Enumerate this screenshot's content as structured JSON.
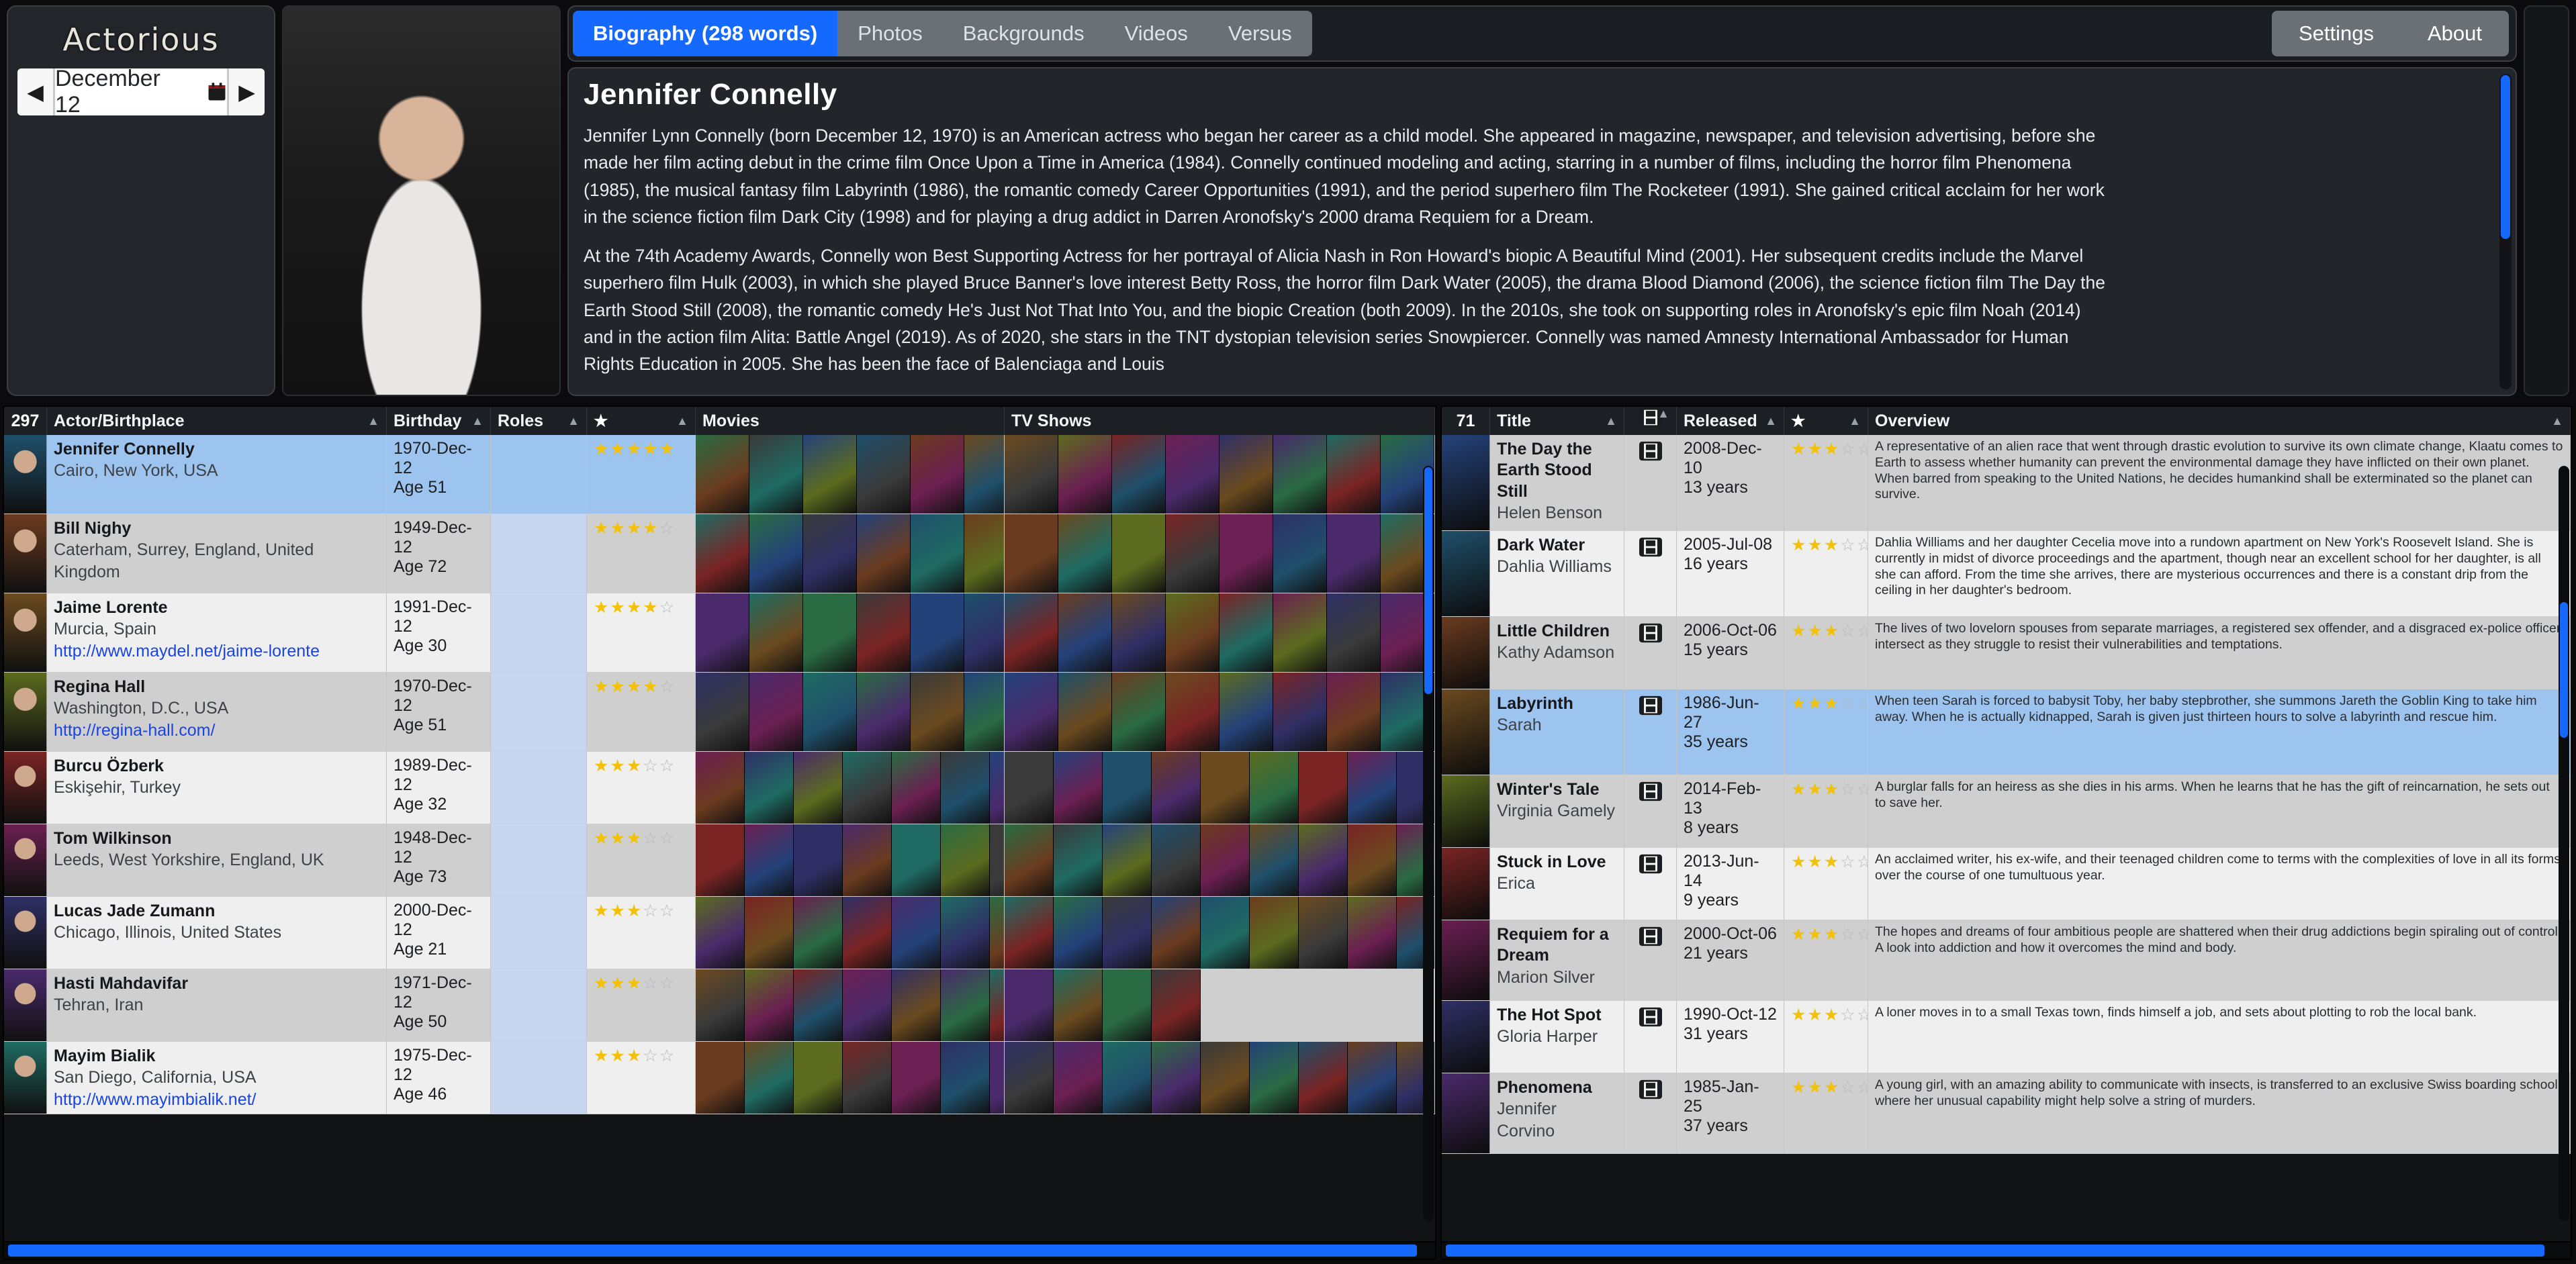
{
  "app": {
    "title": "Actorious"
  },
  "date_nav": {
    "prev": "◀",
    "next": "▶",
    "value": "December 12",
    "icon": "calendar-icon"
  },
  "tabs": [
    {
      "label": "Biography (298 words)",
      "active": true
    },
    {
      "label": "Photos",
      "active": false
    },
    {
      "label": "Backgrounds",
      "active": false
    },
    {
      "label": "Videos",
      "active": false
    },
    {
      "label": "Versus",
      "active": false
    }
  ],
  "top_buttons": [
    {
      "label": "Settings"
    },
    {
      "label": "About"
    }
  ],
  "biography": {
    "name": "Jennifer Connelly",
    "paragraphs": [
      "Jennifer Lynn Connelly (born December 12, 1970) is an American actress who began her career as a child model. She appeared in magazine, newspaper, and television advertising, before she made her film acting debut in the crime film Once Upon a Time in America (1984). Connelly continued modeling and acting, starring in a number of films, including the horror film Phenomena (1985), the musical fantasy film Labyrinth (1986), the romantic comedy Career Opportunities (1991), and the period superhero film The Rocketeer (1991). She gained critical acclaim for her work in the science fiction film Dark City (1998) and for playing a drug addict in Darren Aronofsky's 2000 drama Requiem for a Dream.",
      "At the 74th Academy Awards, Connelly won Best Supporting Actress for her portrayal of Alicia Nash in Ron Howard's biopic A Beautiful Mind (2001). Her subsequent credits include the Marvel superhero film Hulk (2003), in which she played Bruce Banner's love interest Betty Ross, the horror film Dark Water (2005), the drama Blood Diamond (2006), the science fiction film The Day the Earth Stood Still (2008), the romantic comedy He's Just Not That Into You, and the biopic Creation (both 2009). In the 2010s, she took on supporting roles in Aronofsky's epic film Noah (2014) and in the action film Alita: Battle Angel (2019). As of 2020, she stars in the TNT dystopian television series Snowpiercer. Connelly was named Amnesty International Ambassador for Human Rights Education in 2005. She has been the face of Balenciaga and Louis"
    ]
  },
  "actors_grid": {
    "count": "297",
    "columns": [
      {
        "label": "Actor/Birthplace",
        "sortable": true
      },
      {
        "label": "Birthday",
        "sortable": true
      },
      {
        "label": "Roles",
        "sortable": true
      },
      {
        "label": "★",
        "sortable": true
      },
      {
        "label": "Movies",
        "sortable": false
      },
      {
        "label": "TV Shows",
        "sortable": false
      }
    ],
    "rows": [
      {
        "name": "Jennifer Connelly",
        "birthplace": "Cairo, New York, USA",
        "url": "",
        "birthday": "1970-Dec-12",
        "age": "Age 51",
        "roles": "",
        "stars": 5,
        "selected": true
      },
      {
        "name": "Bill Nighy",
        "birthplace": "Caterham, Surrey, England, United Kingdom",
        "url": "",
        "birthday": "1949-Dec-12",
        "age": "Age 72",
        "roles": "",
        "stars": 4,
        "selected": false
      },
      {
        "name": "Jaime Lorente",
        "birthplace": "Murcia, Spain",
        "url": "http://www.maydel.net/jaime-lorente",
        "birthday": "1991-Dec-12",
        "age": "Age 30",
        "roles": "",
        "stars": 4,
        "selected": false
      },
      {
        "name": "Regina Hall",
        "birthplace": "Washington, D.C., USA",
        "url": "http://regina-hall.com/",
        "birthday": "1970-Dec-12",
        "age": "Age 51",
        "roles": "",
        "stars": 4,
        "selected": false
      },
      {
        "name": "Burcu Özberk",
        "birthplace": "Eskişehir, Turkey",
        "url": "",
        "birthday": "1989-Dec-12",
        "age": "Age 32",
        "roles": "",
        "stars": 3,
        "selected": false
      },
      {
        "name": "Tom Wilkinson",
        "birthplace": "Leeds, West Yorkshire, England, UK",
        "url": "",
        "birthday": "1948-Dec-12",
        "age": "Age 73",
        "roles": "",
        "stars": 3,
        "selected": false
      },
      {
        "name": "Lucas Jade Zumann",
        "birthplace": "Chicago, Illinois, United States",
        "url": "",
        "birthday": "2000-Dec-12",
        "age": "Age 21",
        "roles": "",
        "stars": 3,
        "selected": false
      },
      {
        "name": "Hasti Mahdavifar",
        "birthplace": "Tehran, Iran",
        "url": "",
        "birthday": "1971-Dec-12",
        "age": "Age 50",
        "roles": "",
        "stars": 3,
        "selected": false
      },
      {
        "name": "Mayim Bialik",
        "birthplace": "San Diego, California, USA",
        "url": "http://www.mayimbialik.net/",
        "birthday": "1975-Dec-12",
        "age": "Age 46",
        "roles": "",
        "stars": 3,
        "selected": false
      }
    ]
  },
  "titles_grid": {
    "count": "71",
    "columns": [
      {
        "label": "Title",
        "sortable": true
      },
      {
        "label": "film-icon",
        "sortable": true
      },
      {
        "label": "Released",
        "sortable": true
      },
      {
        "label": "★",
        "sortable": true
      },
      {
        "label": "Overview",
        "sortable": true
      }
    ],
    "rows": [
      {
        "title": "The Day the Earth Stood Still",
        "role": "Helen Benson",
        "media": "film-icon",
        "released": "2008-Dec-10",
        "age": "13 years",
        "stars": 3,
        "overview": "A representative of an alien race that went through drastic evolution to survive its own climate change, Klaatu comes to Earth to assess whether humanity can prevent the environmental damage they have inflicted on their own planet. When barred from speaking to the United Nations, he decides humankind shall be exterminated so the planet can survive.",
        "selected": false
      },
      {
        "title": "Dark Water",
        "role": "Dahlia Williams",
        "media": "film-icon",
        "released": "2005-Jul-08",
        "age": "16 years",
        "stars": 3,
        "overview": "Dahlia Williams and her daughter Cecelia move into a rundown apartment on New York's Roosevelt Island. She is currently in midst of divorce proceedings and the apartment, though near an excellent school for her daughter, is all she can afford. From the time she arrives, there are mysterious occurrences and there is a constant drip from the ceiling in her daughter's bedroom.",
        "selected": false
      },
      {
        "title": "Little Children",
        "role": "Kathy Adamson",
        "media": "film-icon",
        "released": "2006-Oct-06",
        "age": "15 years",
        "stars": 3,
        "overview": "The lives of two lovelorn spouses from separate marriages, a registered sex offender, and a disgraced ex-police officer intersect as they struggle to resist their vulnerabilities and temptations.",
        "selected": false
      },
      {
        "title": "Labyrinth",
        "role": "Sarah",
        "media": "film-icon",
        "released": "1986-Jun-27",
        "age": "35 years",
        "stars": 3,
        "overview": "When teen Sarah is forced to babysit Toby, her baby stepbrother, she summons Jareth the Goblin King to take him away. When he is actually kidnapped, Sarah is given just thirteen hours to solve a labyrinth and rescue him.",
        "selected": true
      },
      {
        "title": "Winter's Tale",
        "role": "Virginia Gamely",
        "media": "film-icon",
        "released": "2014-Feb-13",
        "age": "8 years",
        "stars": 3,
        "overview": "A burglar falls for an heiress as she dies in his arms. When he learns that he has the gift of reincarnation, he sets out to save her.",
        "selected": false
      },
      {
        "title": "Stuck in Love",
        "role": "Erica",
        "media": "film-icon",
        "released": "2013-Jun-14",
        "age": "9 years",
        "stars": 3,
        "overview": "An acclaimed writer, his ex-wife, and their teenaged children come to terms with the complexities of love in all its forms over the course of one tumultuous year.",
        "selected": false
      },
      {
        "title": "Requiem for a Dream",
        "role": "Marion Silver",
        "media": "film-icon",
        "released": "2000-Oct-06",
        "age": "21 years",
        "stars": 3,
        "overview": "The hopes and dreams of four ambitious people are shattered when their drug addictions begin spiraling out of control. A look into addiction and how it overcomes the mind and body.",
        "selected": false
      },
      {
        "title": "The Hot Spot",
        "role": "Gloria Harper",
        "media": "film-icon",
        "released": "1990-Oct-12",
        "age": "31 years",
        "stars": 3,
        "overview": "A loner moves in to a small Texas town, finds himself a job, and sets about plotting to rob the local bank.",
        "selected": false
      },
      {
        "title": "Phenomena",
        "role": "Jennifer Corvino",
        "media": "film-icon",
        "released": "1985-Jan-25",
        "age": "37 years",
        "stars": 3,
        "overview": "A young girl, with an amazing ability to communicate with insects, is transferred to an exclusive Swiss boarding school, where her unusual capability might help solve a string of murders.",
        "selected": false
      }
    ]
  },
  "colors": {
    "accent": "#1569ff",
    "selection": "#9dc3ef",
    "star_on": "#f2c108",
    "star_off": "#b6b9bd",
    "link": "#1a45e0",
    "panel_bg": "#22262b"
  }
}
